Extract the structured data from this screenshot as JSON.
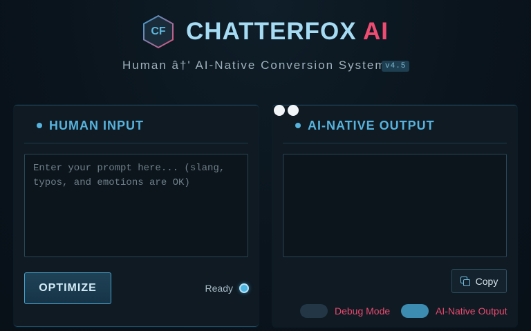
{
  "header": {
    "logo_text": "CF",
    "title_main": "CHATTERFOX",
    "title_accent": "AI",
    "subtitle": "Human â†' AI-Native Conversion System",
    "version": "v4.5"
  },
  "input_panel": {
    "title": "HUMAN INPUT",
    "placeholder": "Enter your prompt here... (slang, typos, and emotions are OK)",
    "value": "",
    "optimize_label": "OPTIMIZE",
    "status": "Ready"
  },
  "output_panel": {
    "title": "AI-NATIVE OUTPUT",
    "value": "",
    "copy_label": "Copy",
    "toggles": [
      {
        "label": "Debug Mode",
        "on": false
      },
      {
        "label": "AI-Native Output",
        "on": true
      }
    ]
  },
  "colors": {
    "accent": "#57b3dd",
    "brand_ai": "#ef4c72",
    "toggle_label": "#ec4a6e",
    "background": "#0a141c"
  },
  "icons": [
    "hexagon-logo-icon",
    "copy-icon"
  ]
}
